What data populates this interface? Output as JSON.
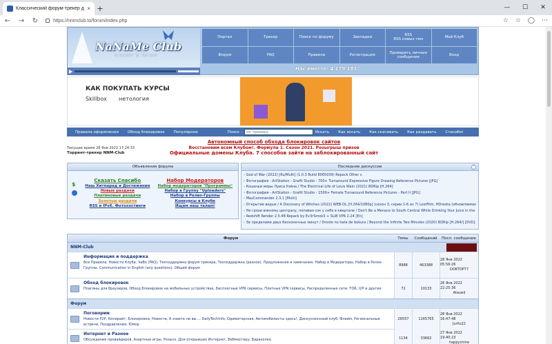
{
  "browser": {
    "tab_title": "Классический форум-трекер д",
    "url": "https://nnmclub.to/forum/index.php",
    "new_tab": "+",
    "close_tab": "×",
    "win_min": "—",
    "win_max": "☐",
    "win_close": "✕"
  },
  "header": {
    "logo": "NaNaMe Club",
    "logo_sub": "tracker & forum",
    "online": "Нас вместе: 4 179 181",
    "menu": [
      "Портал",
      "Трекер",
      "Поиск по форуму",
      "Закладки",
      "RSS\nRSS новых тем",
      "Мой Клуб",
      "Форум",
      "FAQ",
      "Правила",
      "Регистрация",
      "Проверить личные сообщения",
      "Вход"
    ]
  },
  "banner": {
    "title": "КАК ПОКУПАТЬ КУРСЫ",
    "brand1": "Skillbox",
    "brand2": "нетология"
  },
  "navstrip": {
    "items": [
      "Правила оформления",
      "Обход блокировок",
      "Популярное"
    ],
    "search_label": "Поиск :",
    "search_placeholder": "по трекеру",
    "search_btn": "Искать",
    "right": [
      "Как искать",
      "Как скачивать",
      "Как раздавать",
      "Спасибо!"
    ]
  },
  "info": {
    "time": "Текущее время 28 Янв 2022 17:24:33",
    "tracker": "Торрент-трекер NNM-Club",
    "line1": "Автономный способ обхода блокировок сайтов",
    "line2": "Восстановим всем Клубом!. Формула 1. Сезон 2021. Розыгрыш призов",
    "line3": "Официальные домены Клуба. 7 способов зайти на заблокированный сайт"
  },
  "ads": {
    "title": "Объявления форума",
    "thanks": "Сказать Спасибо",
    "hitparade": "Наш Хитпарад и Достижения",
    "new": "Новые раздачи",
    "paid": "Платиновые раздачи",
    "gold": "Золотые раздачи",
    "rss": "RSS и IPv6. Фотохостинги",
    "moder": "Набор Модераторов",
    "moder_progs": "Набор модераторов \"Программы\"",
    "uploaders": "Набор в Группу \"Uploaders\"",
    "release": "Набор в Релиз-Группы",
    "contests": "Конкурсы в Клубе",
    "talent": "Ищем наш талант"
  },
  "discussions": {
    "title": "Последние дискуссии",
    "items": [
      "God of War (2022) [Ru/Multi] (1.0.3 Build 8065039) Repack Other s",
      "Фотография - ArtStation - Grafit Studio - 700+ Turnaround Expressive Figure Drawing Reference Pictures [JPG]",
      "Кошачьи миры Луиса Уэйна / The Electrical Life of Louis Wain (2021) BDRip [H.264]",
      "Фотография - ArtStation - Grafit Studio - 1500+ Female Turnaround Reference Pictures - Part II [JPG]",
      "MaxCommander 2.3.1 [Multi]",
      "Открытие ведьм / A Discovery of Witches (2022) WEB-DL [H.264/1080p] (сезон 3, серии 1-6 из 7) LostFilm, HDrezka (обновляемая)",
      "Не грози южному централу, попивая сок у себя в квартале / Don't Be a Menace to South Central While Drinking Your Juice in the Hood (1996) BDRip [H.265/1080p] [10-bit]",
      "Redshift Render 2.5.48 Repack by Ev3rSmok3 + SLiB VPR 2.24 [En]",
      "За пределами двух бесконечных минут / Droste no hate de bokura / Beyond the Infinite Two Minutes (2020) BDRip [H.264/] [DVD]"
    ]
  },
  "forum": {
    "head": [
      "Форум",
      "Темы",
      "Сообщений",
      "Посл. сообщение"
    ],
    "cat1": "NNM-Club",
    "cat1_banner": "",
    "cat2": "Форум",
    "rows": [
      {
        "title": "Информация и поддержка",
        "subs": "Все Правила, Новости Клуба, ЧаВо (FAQ), Техподдержка форум-трекера, Техподдержка (разное), Предложения и замечания, Набор в Модераторы, Набор в Релиз-Группы, Communication in English (any questions), Общий форум",
        "topics": "8988",
        "posts": "463388",
        "date": "28 Янв 2022 05:56:26",
        "user": "DOKTOP77"
      },
      {
        "title": "Обход блокировок",
        "subs": "Плагины для браузеров, Обход блокировок на мобильных устройствах, Бесплатные VPN сервисы, Платные VPN сервисы, Распределенные сети. TOR, I2P и другие",
        "topics": "72",
        "posts": "10133",
        "date": "26 Янв 2022 22:25:36",
        "user": "Ataued"
      },
      {
        "title": "Поговорим",
        "subs": "Новости P2P, Копирайт, Блокировки, Новости, А знаете ли вы..., DailyTechInfo, Одиматорская, Автомобилисты здесь!, Дискуссионный клуб, Флейм, Региональные встречи, Поздравления, Юмор",
        "topics": "26557",
        "posts": "1165765",
        "date": "28 Янв 2022 16:47:48",
        "user": "Jurlio22"
      },
      {
        "title": "Интернет и Разное",
        "subs": "Обсуждение провайдеров, Азартные игры, Розыск, Для открывших Интернет, Вебмастеру, Барахолка",
        "topics": "1134",
        "posts": "33662",
        "date": "27 Янв 2022 19:40:23",
        "user": "happychine"
      }
    ],
    "watermark": "NaNaMe Club"
  }
}
